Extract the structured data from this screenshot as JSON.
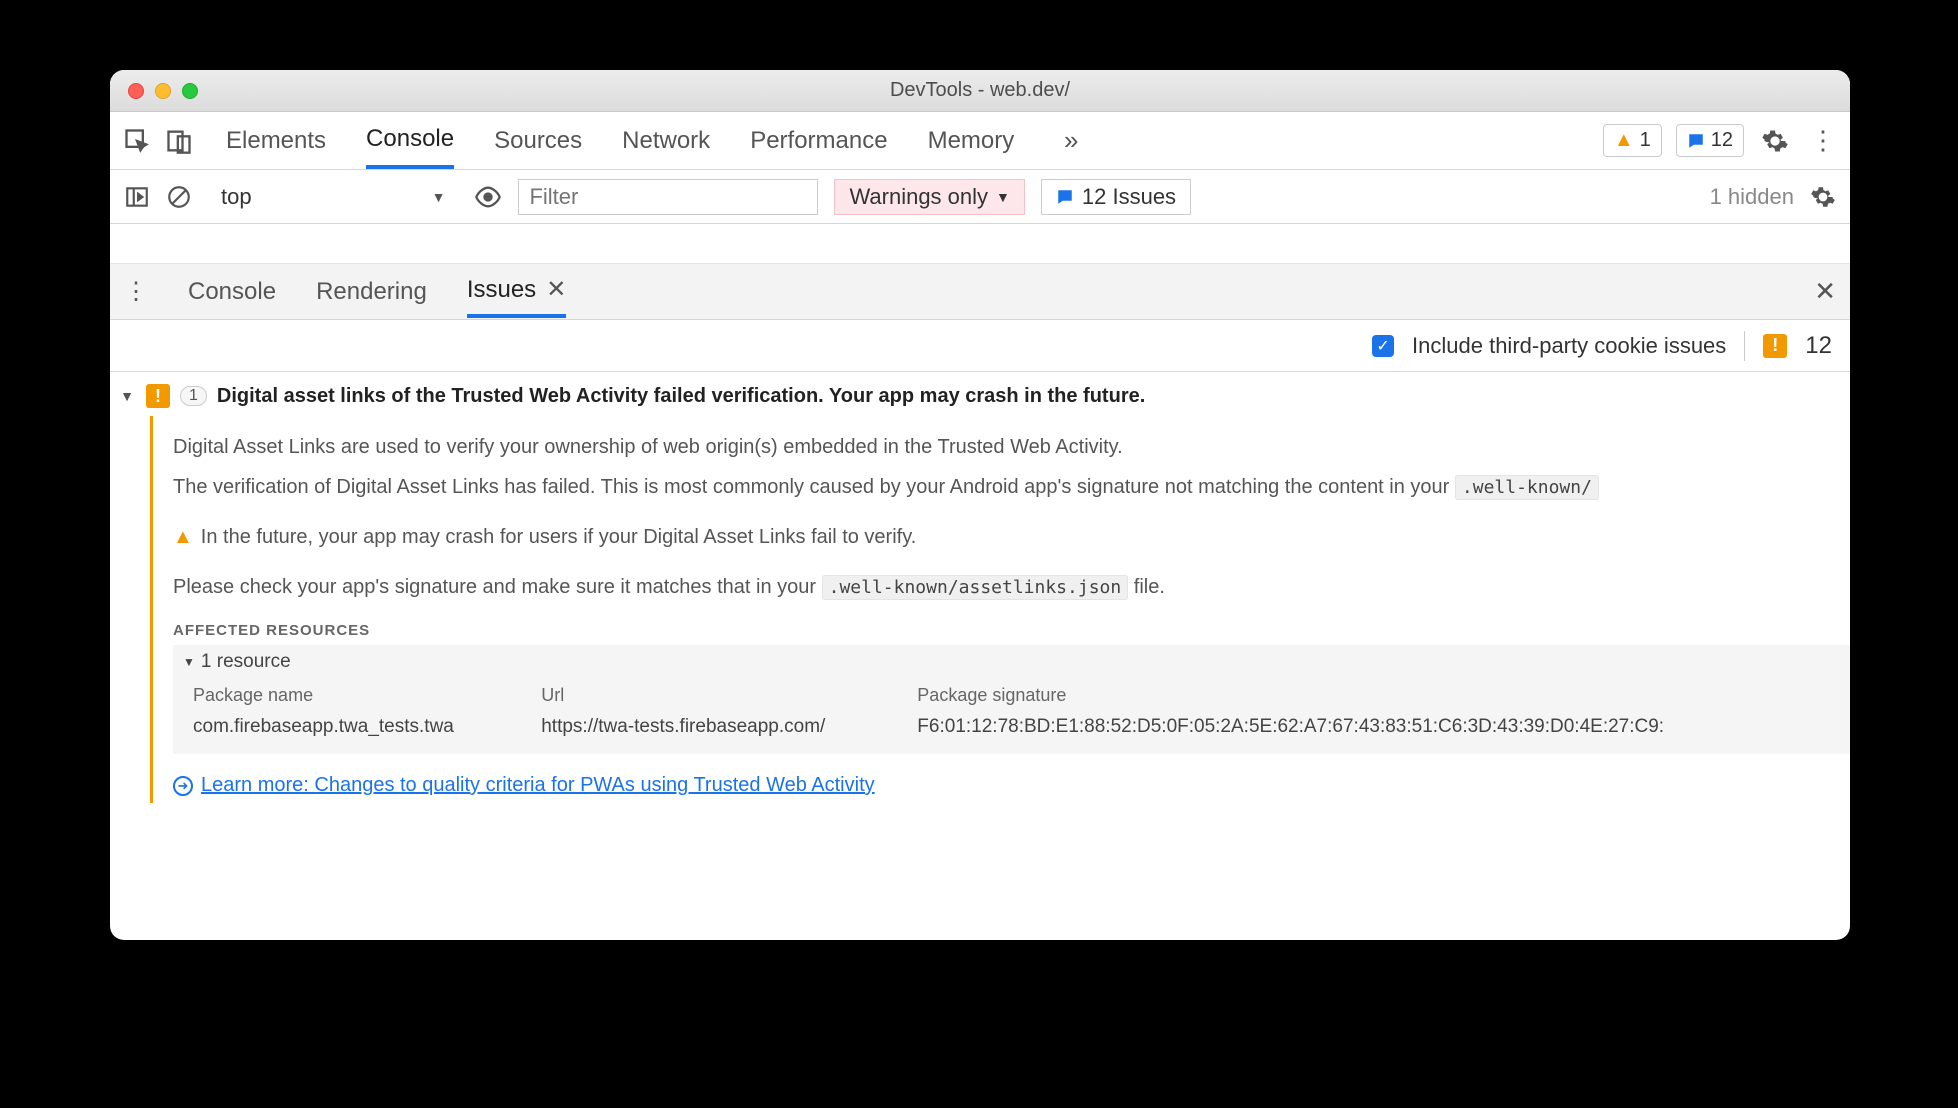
{
  "window": {
    "title": "DevTools - web.dev/"
  },
  "main_tabs": {
    "items": [
      "Elements",
      "Console",
      "Sources",
      "Network",
      "Performance",
      "Memory"
    ],
    "active_index": 1,
    "warnings_count": "1",
    "messages_count": "12"
  },
  "console_bar": {
    "context": "top",
    "filter_placeholder": "Filter",
    "level": "Warnings only",
    "issues_button": "12 Issues",
    "hidden": "1 hidden"
  },
  "drawer": {
    "tabs": [
      "Console",
      "Rendering",
      "Issues"
    ],
    "active_index": 2
  },
  "issues_toolbar": {
    "include_third_party": "Include third-party cookie issues",
    "count": "12"
  },
  "issue": {
    "count": "1",
    "title": "Digital asset links of the Trusted Web Activity failed verification. Your app may crash in the future.",
    "p1": "Digital Asset Links are used to verify your ownership of web origin(s) embedded in the Trusted Web Activity.",
    "p2_prefix": "The verification of Digital Asset Links has failed. This is most commonly caused by your Android app's signature not matching the content in your ",
    "p2_code": ".well-known/",
    "p3": "In the future, your app may crash for users if your Digital Asset Links fail to verify.",
    "p4_prefix": "Please check your app's signature and make sure it matches that in your ",
    "p4_code": ".well-known/assetlinks.json",
    "p4_suffix": " file.",
    "affected_heading": "AFFECTED RESOURCES",
    "resource_summary": "1 resource",
    "columns": {
      "c0": "Package name",
      "c1": "Url",
      "c2": "Package signature"
    },
    "row": {
      "package": "com.firebaseapp.twa_tests.twa",
      "url": "https://twa-tests.firebaseapp.com/",
      "sig": "F6:01:12:78:BD:E1:88:52:D5:0F:05:2A:5E:62:A7:67:43:83:51:C6:3D:43:39:D0:4E:27:C9:"
    },
    "learn_more": "Learn more: Changes to quality criteria for PWAs using Trusted Web Activity"
  }
}
